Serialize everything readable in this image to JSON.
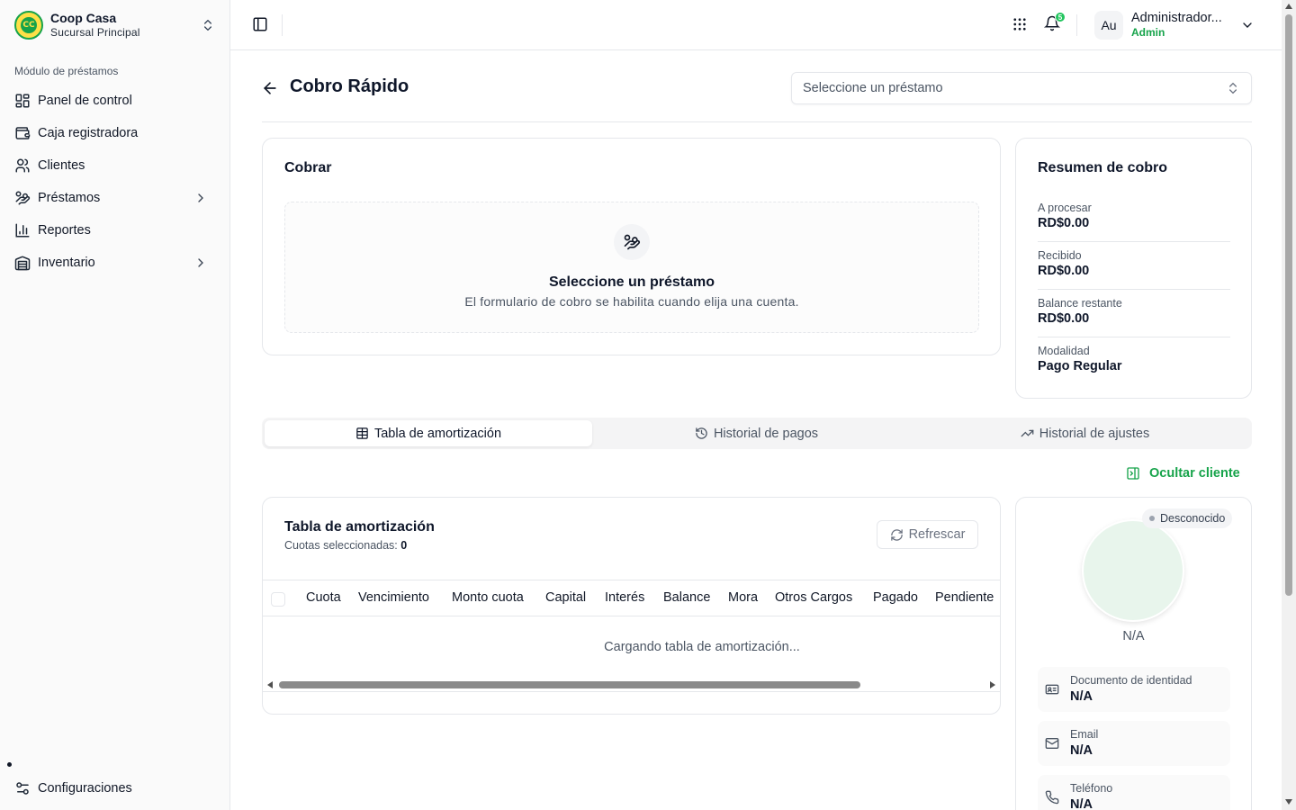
{
  "brand": {
    "name": "Coop Casa",
    "branch": "Sucursal Principal",
    "logo_text": "CC"
  },
  "sidebar": {
    "section_label": "Módulo de préstamos",
    "items": [
      {
        "label": "Panel de control",
        "icon": "dashboard-icon",
        "has_submenu": false
      },
      {
        "label": "Caja registradora",
        "icon": "wallet-icon",
        "has_submenu": false
      },
      {
        "label": "Clientes",
        "icon": "users-icon",
        "has_submenu": false
      },
      {
        "label": "Préstamos",
        "icon": "hand-coins-icon",
        "has_submenu": true
      },
      {
        "label": "Reportes",
        "icon": "bar-chart-icon",
        "has_submenu": false
      },
      {
        "label": "Inventario",
        "icon": "warehouse-icon",
        "has_submenu": true
      }
    ],
    "footer_item": {
      "label": "Configuraciones",
      "icon": "settings-sliders-icon"
    }
  },
  "topbar": {
    "notifications_count": "5",
    "user_initials": "Au",
    "user_name": "Administrador...",
    "user_role": "Admin"
  },
  "page": {
    "title": "Cobro Rápido",
    "loan_select_placeholder": "Seleccione un préstamo"
  },
  "cobrar": {
    "title": "Cobrar",
    "empty_title": "Seleccione un préstamo",
    "empty_subtitle": "El formulario de cobro se habilita cuando elija una cuenta."
  },
  "resumen": {
    "title": "Resumen de cobro",
    "rows": [
      {
        "label": "A procesar",
        "value": "RD$0.00"
      },
      {
        "label": "Recibido",
        "value": "RD$0.00"
      },
      {
        "label": "Balance restante",
        "value": "RD$0.00"
      },
      {
        "label": "Modalidad",
        "value": "Pago Regular"
      }
    ]
  },
  "tabs": [
    {
      "label": "Tabla de amortización",
      "icon": "table-icon",
      "active": true
    },
    {
      "label": "Historial de pagos",
      "icon": "history-icon",
      "active": false
    },
    {
      "label": "Historial de ajustes",
      "icon": "trending-up-icon",
      "active": false
    }
  ],
  "hide_client_label": "Ocultar cliente",
  "amortization": {
    "title": "Tabla de amortización",
    "selected_label": "Cuotas seleccionadas:",
    "selected_count": "0",
    "refresh_label": "Refrescar",
    "columns": [
      "Cuota",
      "Vencimiento",
      "Monto cuota",
      "Capital",
      "Interés",
      "Balance",
      "Mora",
      "Otros Cargos",
      "Pagado",
      "Pendiente"
    ],
    "loading_text": "Cargando tabla de amortización..."
  },
  "client": {
    "status": "Desconocido",
    "name": "N/A",
    "fields": [
      {
        "label": "Documento de identidad",
        "value": "N/A",
        "icon": "id-card-icon"
      },
      {
        "label": "Email",
        "value": "N/A",
        "icon": "mail-icon"
      },
      {
        "label": "Teléfono",
        "value": "N/A",
        "icon": "phone-icon"
      }
    ]
  },
  "colors": {
    "accent": "#16a34a",
    "badge": "#22c55e",
    "avatar_bg": "#e8f5ec"
  }
}
